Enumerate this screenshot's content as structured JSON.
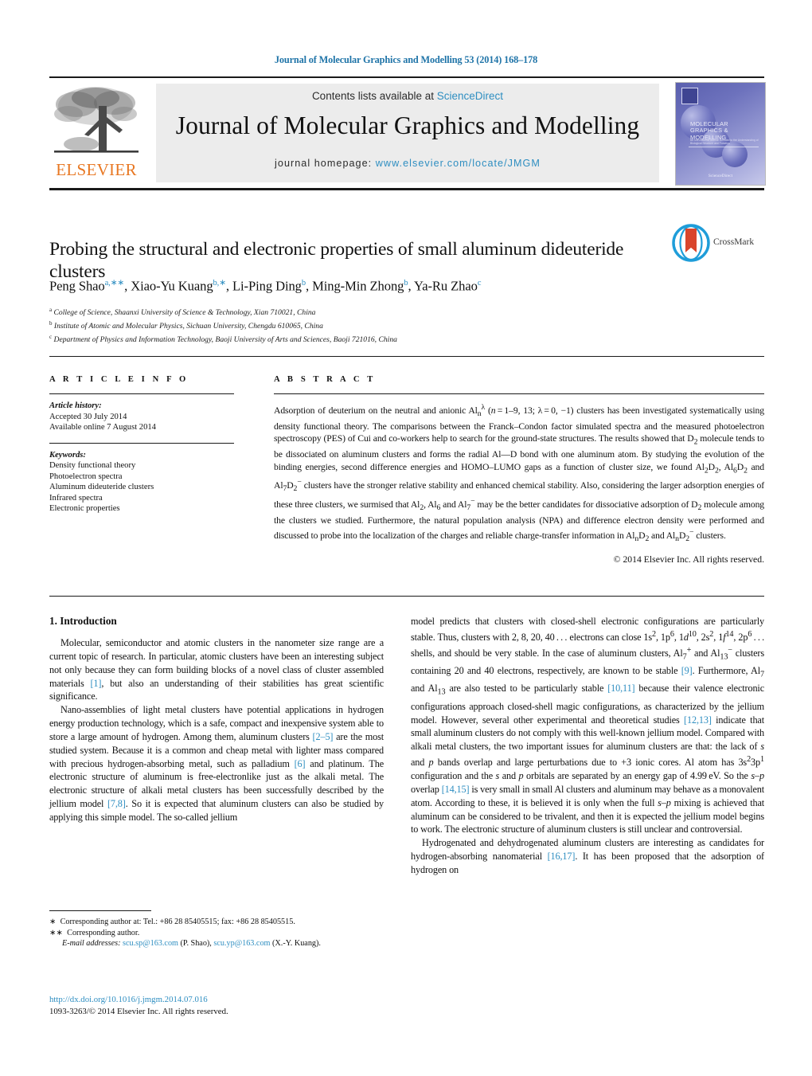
{
  "running_head": "Journal of Molecular Graphics and Modelling 53 (2014) 168–178",
  "masthead": {
    "contents_prefix": "Contents lists available at ",
    "contents_link": "ScienceDirect",
    "journal_title": "Journal of Molecular Graphics and Modelling",
    "homepage_prefix": "journal homepage: ",
    "homepage_url": "www.elsevier.com/locate/JMGM",
    "publisher_logo_text": "ELSEVIER",
    "cover_title": "MOLECULAR GRAPHICS & MODELLING",
    "cover_subtitle": "An International Journal Devoted to the Understanding of Biological Structure and Function",
    "cover_footer": "ScienceDirect"
  },
  "crossmark": {
    "label": "CrossMark"
  },
  "article": {
    "title": "Probing the structural and electronic properties of small aluminum dideuteride clusters",
    "authors": [
      {
        "name": "Peng Shao",
        "sup": "a,∗∗"
      },
      {
        "name": "Xiao-Yu Kuang",
        "sup": "b,∗"
      },
      {
        "name": "Li-Ping Ding",
        "sup": "b"
      },
      {
        "name": "Ming-Min Zhong",
        "sup": "b"
      },
      {
        "name": "Ya-Ru Zhao",
        "sup": "c"
      }
    ],
    "affiliations": [
      {
        "marker": "a",
        "text": "College of Science, Shaanxi University of Science & Technology, Xian 710021, China"
      },
      {
        "marker": "b",
        "text": "Institute of Atomic and Molecular Physics, Sichuan University, Chengdu 610065, China"
      },
      {
        "marker": "c",
        "text": "Department of Physics and Information Technology, Baoji University of Arts and Sciences, Baoji 721016, China"
      }
    ]
  },
  "article_info": {
    "heading": "A R T I C L E   I N F O",
    "history_label": "Article history:",
    "history_lines": [
      "Accepted 30 July 2014",
      "Available online 7 August 2014"
    ],
    "keywords_label": "Keywords:",
    "keywords": [
      "Density functional theory",
      "Photoelectron spectra",
      "Aluminum dideuteride clusters",
      "Infrared spectra",
      "Electronic properties"
    ]
  },
  "abstract": {
    "heading": "A B S T R A C T",
    "copyright": "© 2014 Elsevier Inc. All rights reserved."
  },
  "introduction": {
    "heading": "1.  Introduction"
  },
  "footnotes": {
    "star": "∗",
    "star_text": "Corresponding author at: Tel.: +86 28 85405515; fax: +86 28 85405515.",
    "dstar": "∗∗",
    "dstar_text": "Corresponding author.",
    "email_label": "E-mail addresses:",
    "email1": "scu.sp@163.com",
    "email1_who": "(P. Shao),",
    "email2": "scu.yp@163.com",
    "email2_who": "(X.-Y. Kuang)."
  },
  "doi_block": {
    "doi_url": "http://dx.doi.org/10.1016/j.jmgm.2014.07.016",
    "issn_line": "1093-3263/© 2014 Elsevier Inc. All rights reserved."
  },
  "colors": {
    "link": "#2e8ec1",
    "elsevier_orange": "#e87722",
    "masthead_bg": "#ececec"
  }
}
